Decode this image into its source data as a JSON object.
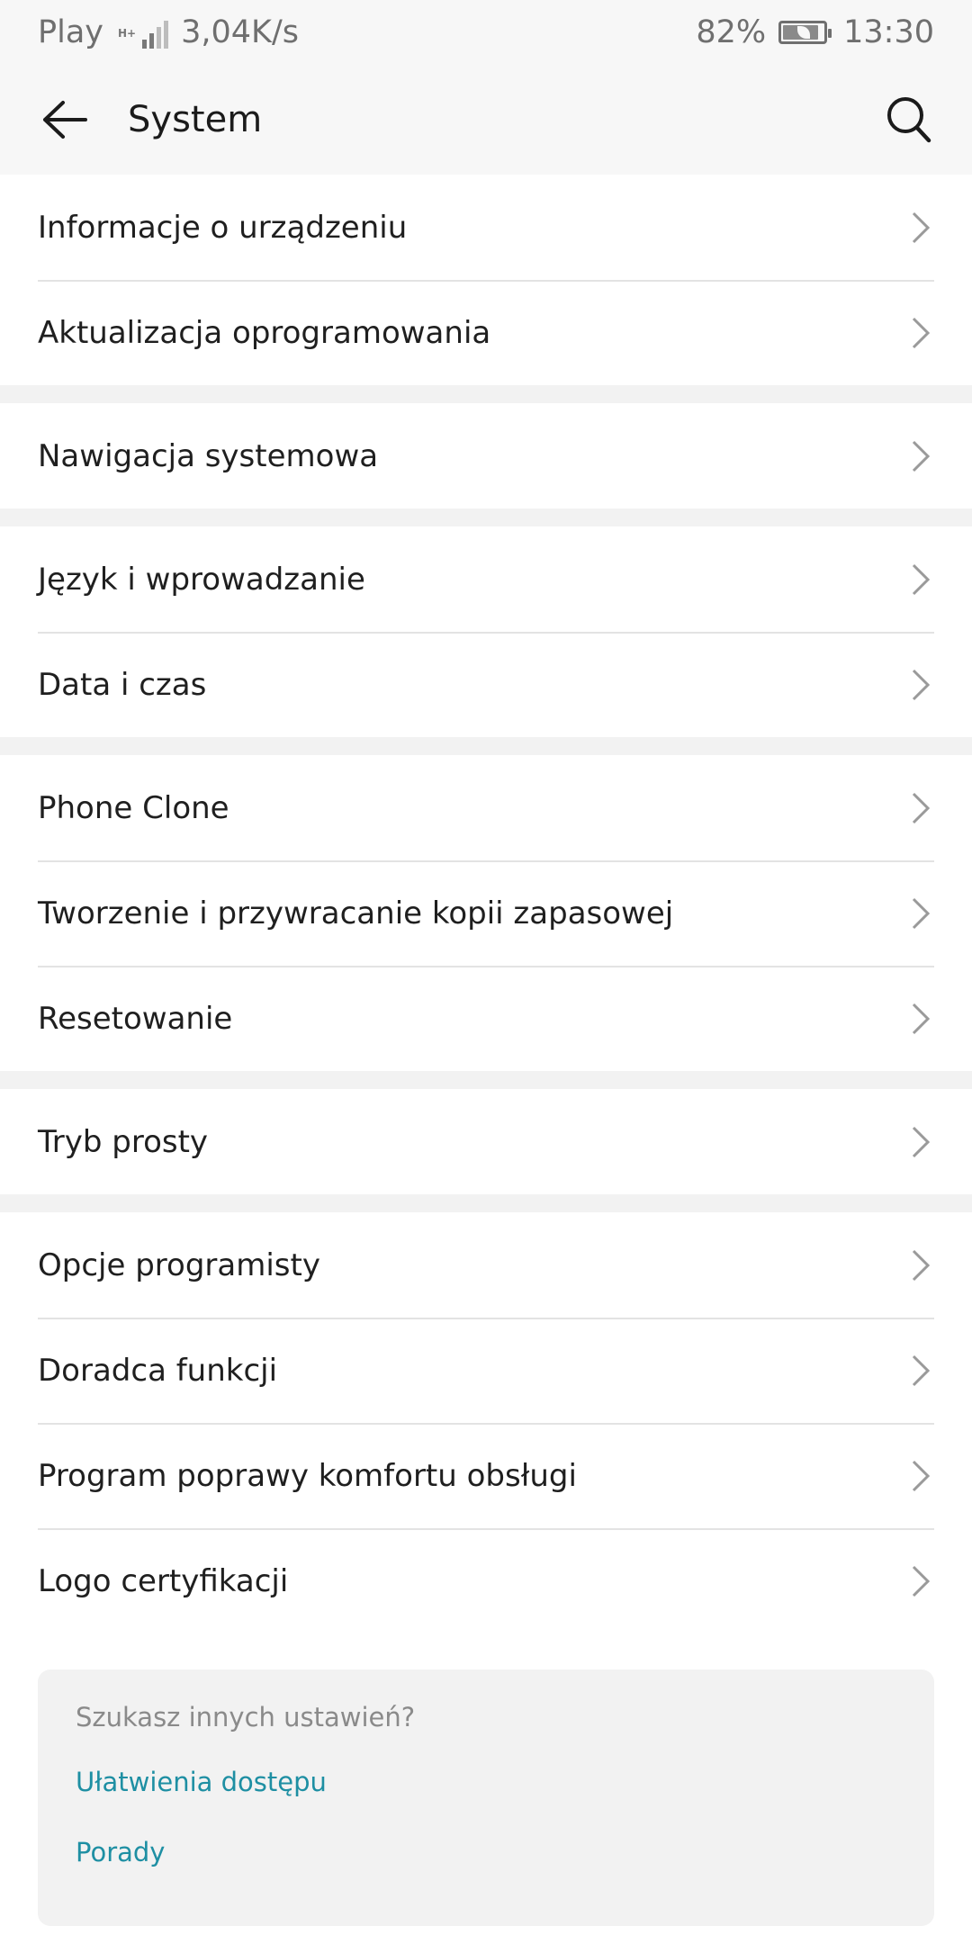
{
  "status_bar": {
    "carrier": "Play",
    "network_type": "H+",
    "speed": "3,04K/s",
    "battery_percent": "82%",
    "battery_level": 0.82,
    "time": "13:30"
  },
  "app_bar": {
    "title": "System",
    "back_icon": "arrow-left-icon",
    "search_icon": "search-icon"
  },
  "groups": [
    {
      "items": [
        {
          "label": "Informacje o urządzeniu"
        },
        {
          "label": "Aktualizacja oprogramowania"
        }
      ]
    },
    {
      "items": [
        {
          "label": "Nawigacja systemowa"
        }
      ]
    },
    {
      "items": [
        {
          "label": "Język i wprowadzanie"
        },
        {
          "label": "Data i czas"
        }
      ]
    },
    {
      "items": [
        {
          "label": "Phone Clone"
        },
        {
          "label": "Tworzenie i przywracanie kopii zapasowej"
        },
        {
          "label": "Resetowanie"
        }
      ]
    },
    {
      "items": [
        {
          "label": "Tryb prosty"
        }
      ]
    },
    {
      "items": [
        {
          "label": "Opcje programisty"
        },
        {
          "label": "Doradca funkcji"
        },
        {
          "label": "Program poprawy komfortu obsługi"
        },
        {
          "label": "Logo certyfikacji"
        }
      ]
    }
  ],
  "suggestions": {
    "title": "Szukasz innych ustawień?",
    "links": [
      {
        "label": "Ułatwienia dostępu"
      },
      {
        "label": "Porady"
      }
    ]
  },
  "colors": {
    "link": "#1e8fa3",
    "background": "#f2f2f2",
    "surface": "#ffffff"
  }
}
